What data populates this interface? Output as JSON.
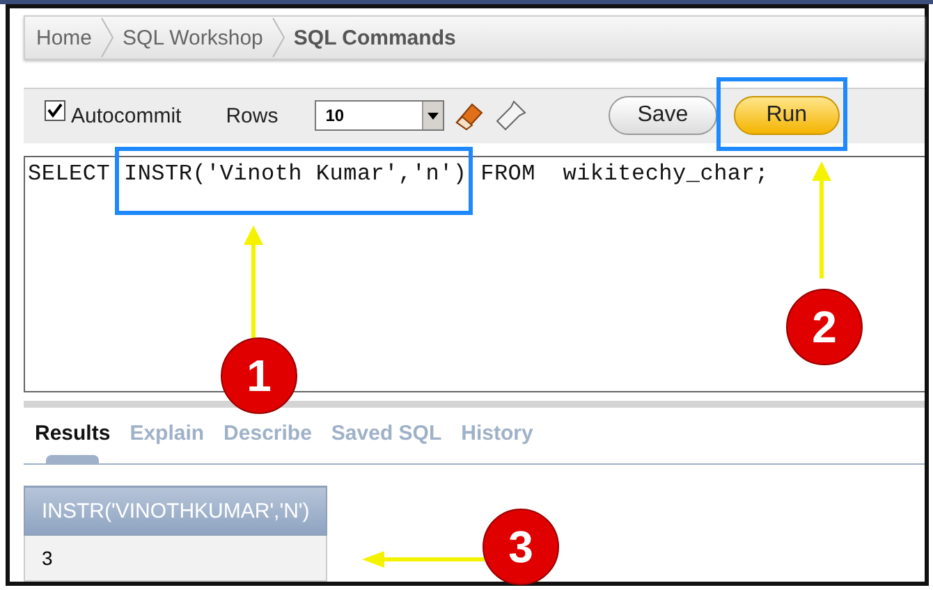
{
  "breadcrumb": [
    {
      "label": "Home",
      "current": false
    },
    {
      "label": "SQL Workshop",
      "current": false
    },
    {
      "label": "SQL Commands",
      "current": true
    }
  ],
  "toolbar": {
    "autocommit": {
      "label": "Autocommit",
      "checked": true
    },
    "rows": {
      "label": "Rows",
      "value": "10"
    },
    "buttons": [
      {
        "label": "Save",
        "kind": "plain"
      },
      {
        "label": "Run",
        "kind": "primary"
      }
    ]
  },
  "editor": {
    "sql": "SELECT INSTR('Vinoth Kumar','n') FROM  wikitechy_char;"
  },
  "tabs": [
    {
      "label": "Results",
      "selected": true
    },
    {
      "label": "Explain",
      "selected": false
    },
    {
      "label": "Describe",
      "selected": false
    },
    {
      "label": "Saved SQL",
      "selected": false
    },
    {
      "label": "History",
      "selected": false
    }
  ],
  "table": {
    "columns": [
      "INSTR('VINOTHKUMAR','N')"
    ],
    "rows": [
      [
        "3"
      ]
    ]
  },
  "annotations": [
    {
      "label": "1",
      "kind": "sql"
    },
    {
      "label": "2",
      "kind": "run"
    },
    {
      "label": "3",
      "kind": "result"
    }
  ]
}
